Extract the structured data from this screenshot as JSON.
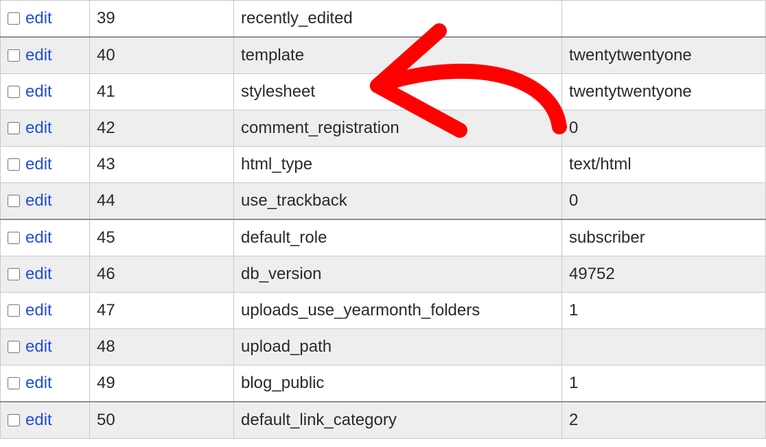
{
  "edit_label": "edit",
  "rows": [
    {
      "id": "39",
      "name": "recently_edited",
      "value": ""
    },
    {
      "id": "40",
      "name": "template",
      "value": "twentytwentyone"
    },
    {
      "id": "41",
      "name": "stylesheet",
      "value": "twentytwentyone"
    },
    {
      "id": "42",
      "name": "comment_registration",
      "value": "0"
    },
    {
      "id": "43",
      "name": "html_type",
      "value": "text/html"
    },
    {
      "id": "44",
      "name": "use_trackback",
      "value": "0"
    },
    {
      "id": "45",
      "name": "default_role",
      "value": "subscriber"
    },
    {
      "id": "46",
      "name": "db_version",
      "value": "49752"
    },
    {
      "id": "47",
      "name": "uploads_use_yearmonth_folders",
      "value": "1"
    },
    {
      "id": "48",
      "name": "upload_path",
      "value": ""
    },
    {
      "id": "49",
      "name": "blog_public",
      "value": "1"
    },
    {
      "id": "50",
      "name": "default_link_category",
      "value": "2"
    }
  ],
  "annotation": {
    "color": "#ff0000",
    "kind": "arrow-curved-left"
  }
}
